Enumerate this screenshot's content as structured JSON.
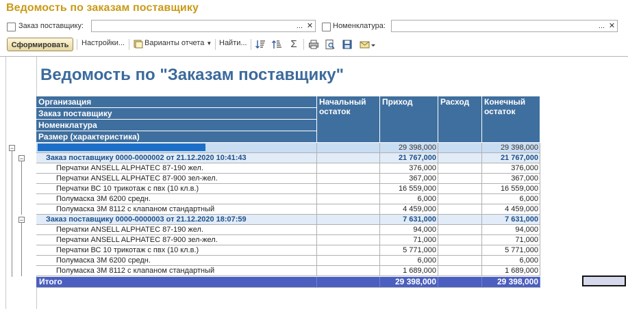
{
  "window": {
    "title": "Ведомость по заказам поставщику"
  },
  "filters": {
    "supplier_order": {
      "label": "Заказ поставщику:",
      "value": ""
    },
    "nomenclature": {
      "label": "Номенклатура:",
      "value": ""
    },
    "dots": "...",
    "clear": "✕"
  },
  "toolbar": {
    "generate": "Сформировать",
    "settings": "Настройки...",
    "variants": "Варианты отчета",
    "find": "Найти..."
  },
  "report": {
    "title": "Ведомость по \"Заказам поставщику\"",
    "headers": {
      "group": [
        "Организация",
        "Заказ поставщику",
        "Номенклатура",
        "Размер (характеристика)"
      ],
      "start": "Начальный остаток",
      "in": "Приход",
      "out": "Расход",
      "end": "Конечный остаток"
    },
    "rows": [
      {
        "level": 0,
        "name": "",
        "start": "",
        "in": "29 398,000",
        "out": "",
        "end": "29 398,000"
      },
      {
        "level": 1,
        "name": "Заказ поставщику 0000-0000002 от 21.12.2020 10:41:43",
        "start": "",
        "in": "21 767,000",
        "out": "",
        "end": "21 767,000"
      },
      {
        "level": 2,
        "name": "Перчатки ANSELL ALPHATEC 87-190 жел.",
        "start": "",
        "in": "376,000",
        "out": "",
        "end": "376,000"
      },
      {
        "level": 2,
        "name": "Перчатки ANSELL ALPHATEC 87-900 зел-жел.",
        "start": "",
        "in": "367,000",
        "out": "",
        "end": "367,000"
      },
      {
        "level": 2,
        "name": "Перчатки ВС 10 трикотаж с пвх (10 кл.в.)",
        "start": "",
        "in": "16 559,000",
        "out": "",
        "end": "16 559,000"
      },
      {
        "level": 2,
        "name": "Полумаска 3М 6200 средн.",
        "start": "",
        "in": "6,000",
        "out": "",
        "end": "6,000"
      },
      {
        "level": 2,
        "name": "Полумаска 3М 8112 с клапаном стандартный",
        "start": "",
        "in": "4 459,000",
        "out": "",
        "end": "4 459,000"
      },
      {
        "level": 1,
        "name": "Заказ поставщику 0000-0000003 от 21.12.2020 18:07:59",
        "start": "",
        "in": "7 631,000",
        "out": "",
        "end": "7 631,000"
      },
      {
        "level": 2,
        "name": "Перчатки ANSELL ALPHATEC 87-190 жел.",
        "start": "",
        "in": "94,000",
        "out": "",
        "end": "94,000"
      },
      {
        "level": 2,
        "name": "Перчатки ANSELL ALPHATEC 87-900 зел-жел.",
        "start": "",
        "in": "71,000",
        "out": "",
        "end": "71,000"
      },
      {
        "level": 2,
        "name": "Перчатки ВС 10 трикотаж с пвх (10 кл.в.)",
        "start": "",
        "in": "5 771,000",
        "out": "",
        "end": "5 771,000"
      },
      {
        "level": 2,
        "name": "Полумаска 3М 6200 средн.",
        "start": "",
        "in": "6,000",
        "out": "",
        "end": "6,000"
      },
      {
        "level": 2,
        "name": "Полумаска 3М 8112 с клапаном стандартный",
        "start": "",
        "in": "1 689,000",
        "out": "",
        "end": "1 689,000"
      }
    ],
    "total": {
      "name": "Итого",
      "start": "",
      "in": "29 398,000",
      "out": "",
      "end": "29 398,000"
    }
  },
  "icons": [
    "sort-desc-icon",
    "sort-asc-icon",
    "sum-icon",
    "print-icon",
    "preview-icon",
    "save-icon",
    "mail-icon"
  ],
  "colors": {
    "title": "#c99a16",
    "header": "#3f6f9e",
    "group0": "#c9ddf2",
    "group1": "#e1ecf8",
    "total": "#4a5fbf",
    "report_title": "#3c6a9c"
  }
}
